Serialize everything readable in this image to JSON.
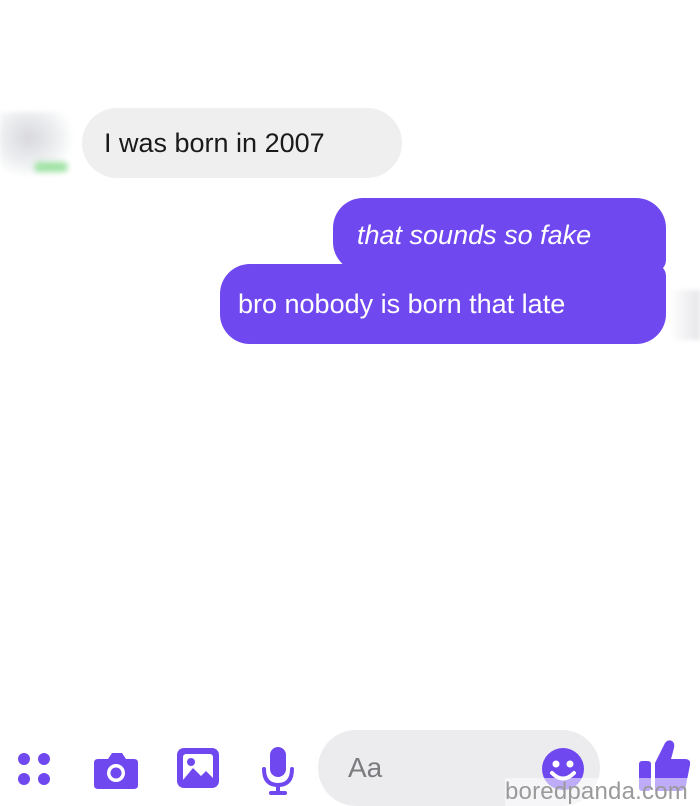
{
  "messages": [
    {
      "direction": "incoming",
      "text": "I was born in 2007"
    },
    {
      "direction": "outgoing",
      "text": "that sounds so fake"
    },
    {
      "direction": "outgoing",
      "text": "bro nobody is born that late"
    }
  ],
  "composer": {
    "placeholder": "Aa",
    "icons": [
      "more-dots-icon",
      "camera-icon",
      "image-icon",
      "microphone-icon",
      "emoji-icon",
      "thumbs-up-icon"
    ]
  },
  "colors": {
    "accent": "#7048f0",
    "incoming_bubble": "#efefef",
    "outgoing_text": "#ffffff"
  },
  "watermark": "boredpanda.com"
}
